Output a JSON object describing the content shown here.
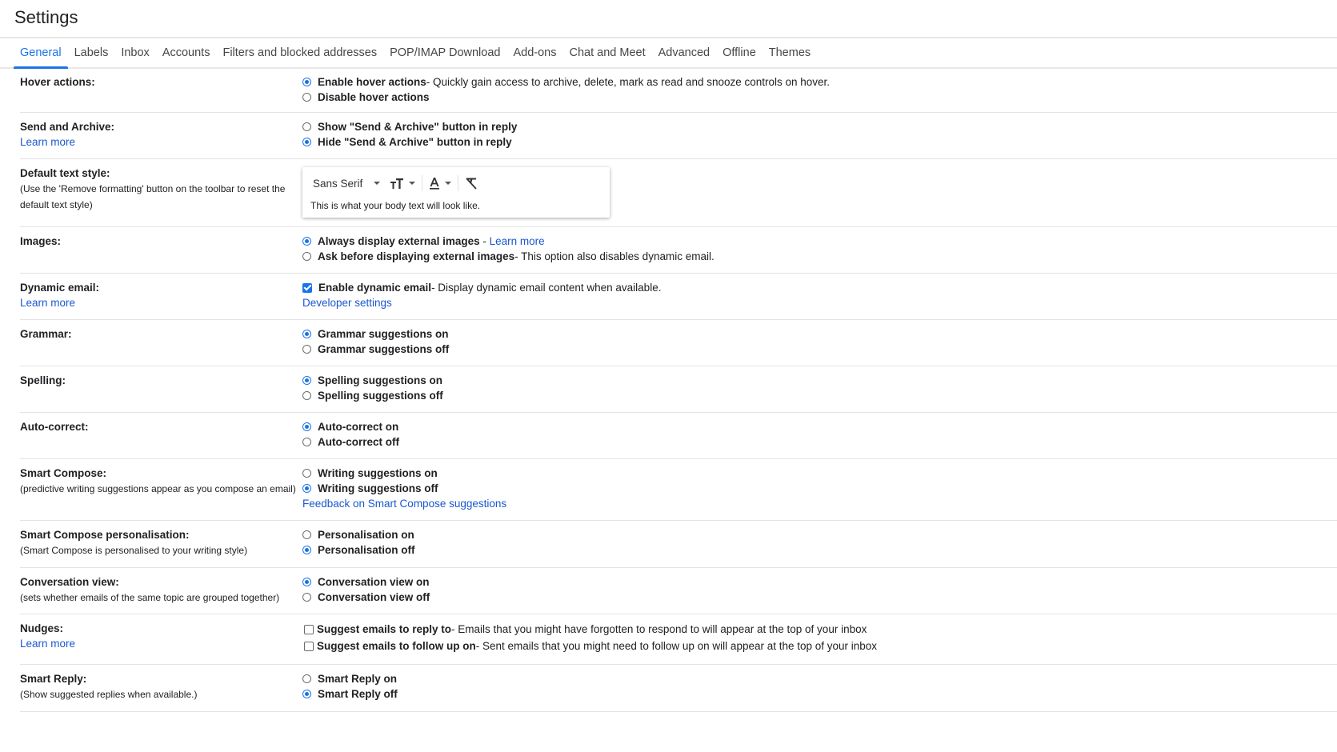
{
  "header": {
    "title": "Settings"
  },
  "tabs": [
    {
      "label": "General",
      "active": true
    },
    {
      "label": "Labels"
    },
    {
      "label": "Inbox"
    },
    {
      "label": "Accounts"
    },
    {
      "label": "Filters and blocked addresses"
    },
    {
      "label": "POP/IMAP Download"
    },
    {
      "label": "Add-ons"
    },
    {
      "label": "Chat and Meet"
    },
    {
      "label": "Advanced"
    },
    {
      "label": "Offline"
    },
    {
      "label": "Themes"
    }
  ],
  "colors": {
    "accent": "#1a73e8",
    "link": "#1a57d1",
    "text": "#202124",
    "divider": "#e3e3e3"
  },
  "settings": {
    "hover_actions": {
      "label": "Hover actions:",
      "options": [
        {
          "label": "Enable hover actions",
          "desc": " - Quickly gain access to archive, delete, mark as read and snooze controls on hover.",
          "selected": true
        },
        {
          "label": "Disable hover actions",
          "selected": false
        }
      ]
    },
    "send_archive": {
      "label": "Send and Archive:",
      "learn_more": "Learn more",
      "options": [
        {
          "label": "Show \"Send & Archive\" button in reply",
          "selected": false
        },
        {
          "label": "Hide \"Send & Archive\" button in reply",
          "selected": true
        }
      ]
    },
    "text_style": {
      "label": "Default text style:",
      "sub": "(Use the 'Remove formatting' button on the toolbar to reset the default text style)",
      "font": "Sans Serif",
      "size_icon": "text-size-icon",
      "color_icon": "text-color-icon",
      "remove_icon": "remove-formatting-icon",
      "preview": "This is what your body text will look like."
    },
    "images": {
      "label": "Images:",
      "options": [
        {
          "label": "Always display external images",
          "desc": " - ",
          "link": "Learn more",
          "selected": true
        },
        {
          "label": "Ask before displaying external images",
          "desc": " - This option also disables dynamic email.",
          "selected": false
        }
      ]
    },
    "dynamic_email": {
      "label": "Dynamic email:",
      "learn_more": "Learn more",
      "option": {
        "label": "Enable dynamic email",
        "desc": " - Display dynamic email content when available.",
        "checked": true
      },
      "developer_link": "Developer settings"
    },
    "grammar": {
      "label": "Grammar:",
      "options": [
        {
          "label": "Grammar suggestions on",
          "selected": true
        },
        {
          "label": "Grammar suggestions off",
          "selected": false
        }
      ]
    },
    "spelling": {
      "label": "Spelling:",
      "options": [
        {
          "label": "Spelling suggestions on",
          "selected": true
        },
        {
          "label": "Spelling suggestions off",
          "selected": false
        }
      ]
    },
    "autocorrect": {
      "label": "Auto-correct:",
      "options": [
        {
          "label": "Auto-correct on",
          "selected": true
        },
        {
          "label": "Auto-correct off",
          "selected": false
        }
      ]
    },
    "smart_compose": {
      "label": "Smart Compose:",
      "sub": "(predictive writing suggestions appear as you compose an email)",
      "options": [
        {
          "label": "Writing suggestions on",
          "selected": false
        },
        {
          "label": "Writing suggestions off",
          "selected": true
        }
      ],
      "feedback_link": "Feedback on Smart Compose suggestions"
    },
    "personalisation": {
      "label": "Smart Compose personalisation:",
      "sub": "(Smart Compose is personalised to your writing style)",
      "options": [
        {
          "label": "Personalisation on",
          "selected": false
        },
        {
          "label": "Personalisation off",
          "selected": true
        }
      ]
    },
    "conversation": {
      "label": "Conversation view:",
      "sub": "(sets whether emails of the same topic are grouped together)",
      "options": [
        {
          "label": "Conversation view on",
          "selected": true
        },
        {
          "label": "Conversation view off",
          "selected": false
        }
      ]
    },
    "nudges": {
      "label": "Nudges:",
      "learn_more": "Learn more",
      "options": [
        {
          "label": "Suggest emails to reply to",
          "desc": " - Emails that you might have forgotten to respond to will appear at the top of your inbox",
          "checked": false
        },
        {
          "label": "Suggest emails to follow up on",
          "desc": " - Sent emails that you might need to follow up on will appear at the top of your inbox",
          "checked": false
        }
      ]
    },
    "smart_reply": {
      "label": "Smart Reply:",
      "sub": "(Show suggested replies when available.)",
      "options": [
        {
          "label": "Smart Reply on",
          "selected": false
        },
        {
          "label": "Smart Reply off",
          "selected": true
        }
      ]
    }
  }
}
